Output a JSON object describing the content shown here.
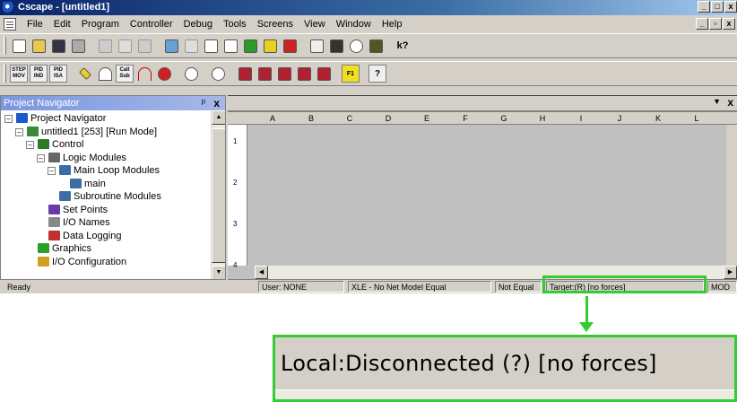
{
  "window": {
    "title": "Cscape - [untitled1]",
    "controls": [
      "_",
      "□",
      "x"
    ],
    "mdi_controls": [
      "_",
      "ä",
      "x"
    ]
  },
  "menubar": {
    "items": [
      "File",
      "Edit",
      "Program",
      "Controller",
      "Debug",
      "Tools",
      "Screens",
      "View",
      "Window",
      "Help"
    ]
  },
  "toolbar2": {
    "labels": [
      "STEP\nMOV",
      "PID\nIND",
      "PID\nISA",
      "Call\nSub",
      "F1",
      "?"
    ]
  },
  "navigator": {
    "title": "Project Navigator",
    "pin": "ᵖ",
    "close": "x",
    "tree": [
      {
        "label": "Project Navigator",
        "level": 0,
        "expander": "–",
        "icon": "navigator-icon"
      },
      {
        "label": "untitled1 [253] [Run Mode]",
        "level": 1,
        "expander": "–",
        "icon": "network-icon"
      },
      {
        "label": "Control",
        "level": 2,
        "expander": "–",
        "icon": "control-icon"
      },
      {
        "label": "Logic Modules",
        "level": 3,
        "expander": "–",
        "icon": "logic-modules-icon"
      },
      {
        "label": "Main Loop Modules",
        "level": 4,
        "expander": "–",
        "icon": "main-loop-icon"
      },
      {
        "label": "main",
        "level": 5,
        "expander": "",
        "icon": "main-module-icon"
      },
      {
        "label": "Subroutine Modules",
        "level": 4,
        "expander": "",
        "icon": "subroutine-icon"
      },
      {
        "label": "Set Points",
        "level": 3,
        "expander": "",
        "icon": "set-points-icon"
      },
      {
        "label": "I/O Names",
        "level": 3,
        "expander": "",
        "icon": "io-names-icon"
      },
      {
        "label": "Data Logging",
        "level": 3,
        "expander": "",
        "icon": "data-logging-icon"
      },
      {
        "label": "Graphics",
        "level": 2,
        "expander": "",
        "icon": "graphics-icon"
      },
      {
        "label": "I/O Configuration",
        "level": 2,
        "expander": "",
        "icon": "io-config-icon"
      }
    ]
  },
  "document": {
    "columns": [
      "A",
      "B",
      "C",
      "D",
      "E",
      "F",
      "G",
      "H",
      "I",
      "J",
      "K",
      "L"
    ],
    "rows": [
      "1",
      "2",
      "3",
      "4"
    ]
  },
  "statusbar": {
    "ready": "Ready",
    "user": "User: NONE",
    "model": "XLE - No Net Model Equal",
    "equal": "Not Equal",
    "target": "Target:(R) [no forces]",
    "mod": "MOD"
  },
  "callout": {
    "text": "Local:Disconnected (?) [no forces]",
    "color": "#33cc33"
  }
}
